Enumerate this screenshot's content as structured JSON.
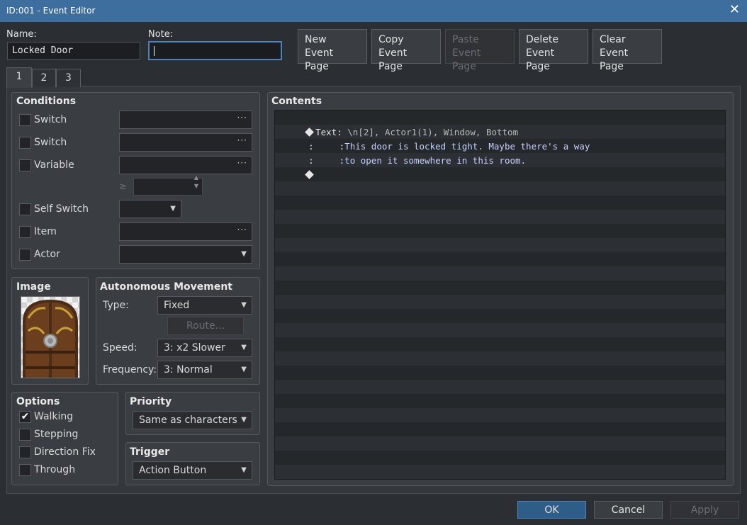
{
  "window": {
    "title": "ID:001 - Event Editor",
    "close_symbol": "✕"
  },
  "header": {
    "name_label": "Name:",
    "name_value": "Locked Door",
    "note_label": "Note:",
    "note_value": "",
    "buttons": [
      {
        "line1": "New",
        "line2": "Event Page",
        "enabled": true
      },
      {
        "line1": "Copy",
        "line2": "Event Page",
        "enabled": true
      },
      {
        "line1": "Paste",
        "line2": "Event Page",
        "enabled": false
      },
      {
        "line1": "Delete",
        "line2": "Event Page",
        "enabled": true
      },
      {
        "line1": "Clear",
        "line2": "Event Page",
        "enabled": true
      }
    ]
  },
  "tabs": [
    "1",
    "2",
    "3"
  ],
  "active_tab": "1",
  "conditions": {
    "title": "Conditions",
    "rows": [
      {
        "label": "Switch",
        "checked": false,
        "control": "picker"
      },
      {
        "label": "Switch",
        "checked": false,
        "control": "picker"
      },
      {
        "label": "Variable",
        "checked": false,
        "control": "picker"
      },
      {
        "label": "Self Switch",
        "checked": false,
        "control": "dropdown"
      },
      {
        "label": "Item",
        "checked": false,
        "control": "picker"
      },
      {
        "label": "Actor",
        "checked": false,
        "control": "dropdown"
      }
    ],
    "variable_compare_symbol": "≥"
  },
  "image": {
    "title": "Image",
    "icon": "door-graphic"
  },
  "movement": {
    "title": "Autonomous Movement",
    "type_label": "Type:",
    "type_value": "Fixed",
    "route_label": "Route...",
    "speed_label": "Speed:",
    "speed_value": "3: x2 Slower",
    "frequency_label": "Frequency:",
    "frequency_value": "3: Normal"
  },
  "options": {
    "title": "Options",
    "items": [
      {
        "label": "Walking",
        "checked": true
      },
      {
        "label": "Stepping",
        "checked": false
      },
      {
        "label": "Direction Fix",
        "checked": false
      },
      {
        "label": "Through",
        "checked": false
      }
    ]
  },
  "priority": {
    "title": "Priority",
    "value": "Same as characters"
  },
  "trigger": {
    "title": "Trigger",
    "value": "Action Button"
  },
  "contents": {
    "title": "Contents",
    "commands": [
      {
        "marker": "diamond",
        "name": "Text",
        "sep": ":",
        "text": "\\n[2], Actor1(1), Window, Bottom",
        "style": "grey"
      },
      {
        "marker": ":",
        "name": "",
        "sep": ":",
        "text": "This door is locked tight. Maybe there's a way",
        "style": "blue"
      },
      {
        "marker": ":",
        "name": "",
        "sep": ":",
        "text": "to open it somewhere in this room.",
        "style": "blue"
      },
      {
        "marker": "diamond",
        "name": "",
        "sep": "",
        "text": "",
        "style": "white"
      }
    ]
  },
  "footer": {
    "ok": "OK",
    "cancel": "Cancel",
    "apply": "Apply"
  },
  "colors": {
    "titlebar": "#3e6e9e",
    "focus_border": "#4f83b8",
    "message_text": "#c8d0ff"
  }
}
